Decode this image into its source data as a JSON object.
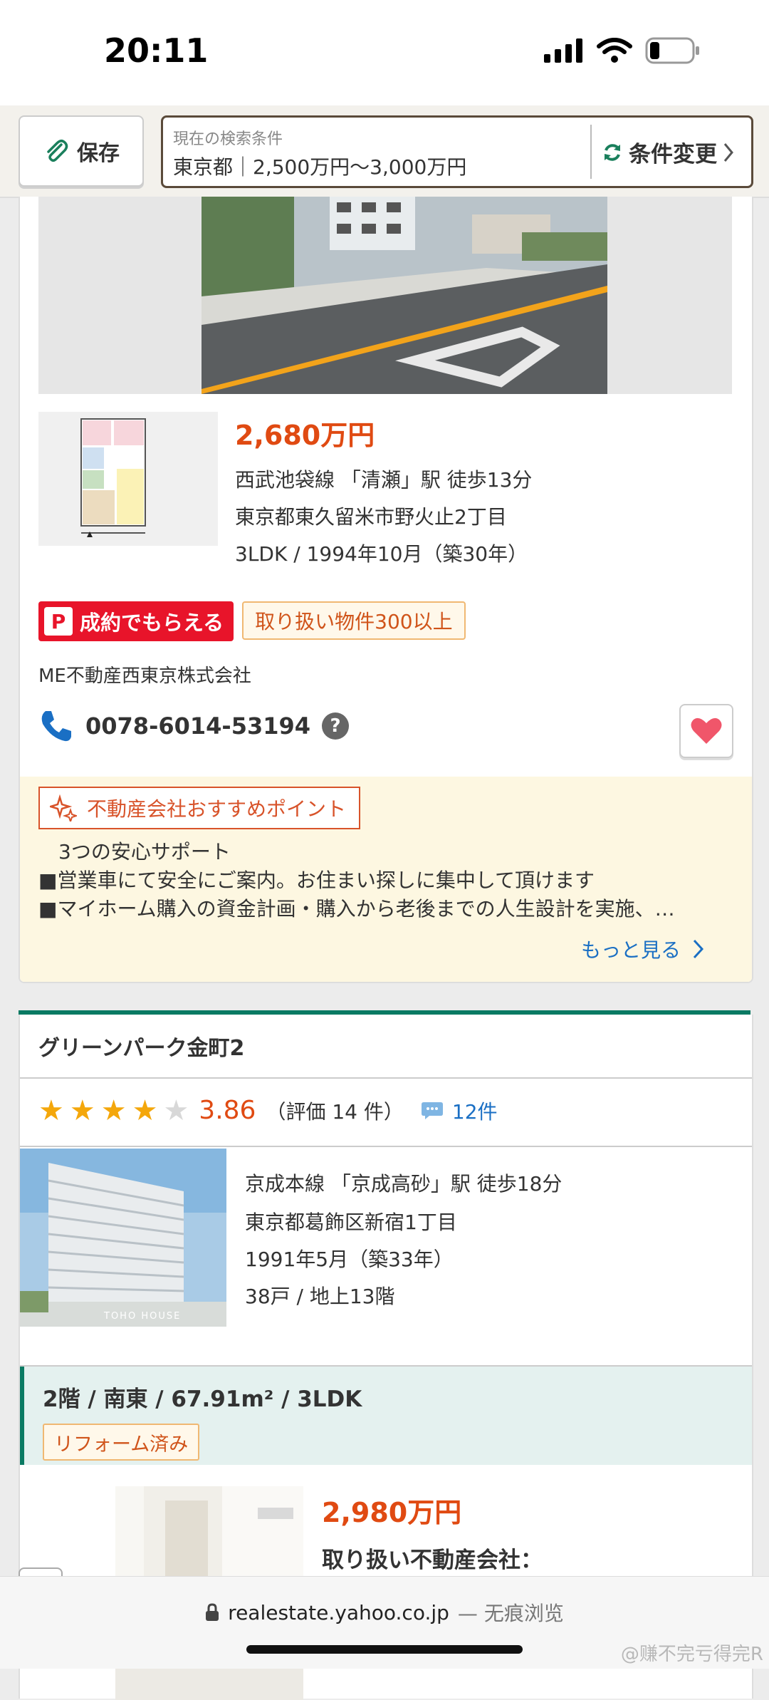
{
  "status_bar": {
    "time": "20:11"
  },
  "search": {
    "save_label": "保存",
    "condition_label": "現在の検索条件",
    "condition_value": "東京都｜2,500万円〜3,000万円",
    "change_label": "条件変更"
  },
  "listing1": {
    "price": "2,680万円",
    "station": "西武池袋線 「清瀬」駅 徒歩13分",
    "address": "東京都東久留米市野火止2丁目",
    "layout": "3LDK / 1994年10月（築30年）",
    "paypay_badge": "成約でもらえる",
    "paypay_logo": "P",
    "count_badge": "取り扱い物件300以上",
    "agency": "ME不動産西東京株式会社",
    "phone": "0078-6014-53194",
    "help": "?",
    "recommend": {
      "title": "不動産会社おすすめポイント",
      "lines": [
        "　3つの安心サポート",
        "■営業車にて安全にご案内。お住まい探しに集中して頂けます",
        "■マイホーム購入の資金計画・購入から老後までの人生設計を実施、…"
      ],
      "more": "もっと見る"
    }
  },
  "listing2": {
    "name": "グリーンパーク金町2",
    "rating": {
      "stars": 4,
      "max": 5,
      "score": "3.86",
      "count_text": "（評価 14 件）",
      "reviews": "12件"
    },
    "photo_caption": "TOHO HOUSE",
    "details": [
      "京成本線 「京成高砂」駅 徒歩18分",
      "東京都葛飾区新宿1丁目",
      "1991年5月（築33年）",
      "38戸 / 地上13階"
    ],
    "unit": {
      "title": "2階 / 南東 / 67.91m² / 3LDK",
      "badge": "リフォーム済み",
      "price": "2,980万円",
      "handling": "取り扱い不動産会社："
    }
  },
  "browser": {
    "url": "realestate.yahoo.co.jp",
    "suffix": "— 无痕浏览",
    "watermark": "@赚不完亏得完R"
  },
  "colors": {
    "price": "#e04a12",
    "accent_green": "#0a7a63",
    "link": "#1a6fc4",
    "paypay_red": "#e8142a",
    "star": "#f4a70b"
  }
}
